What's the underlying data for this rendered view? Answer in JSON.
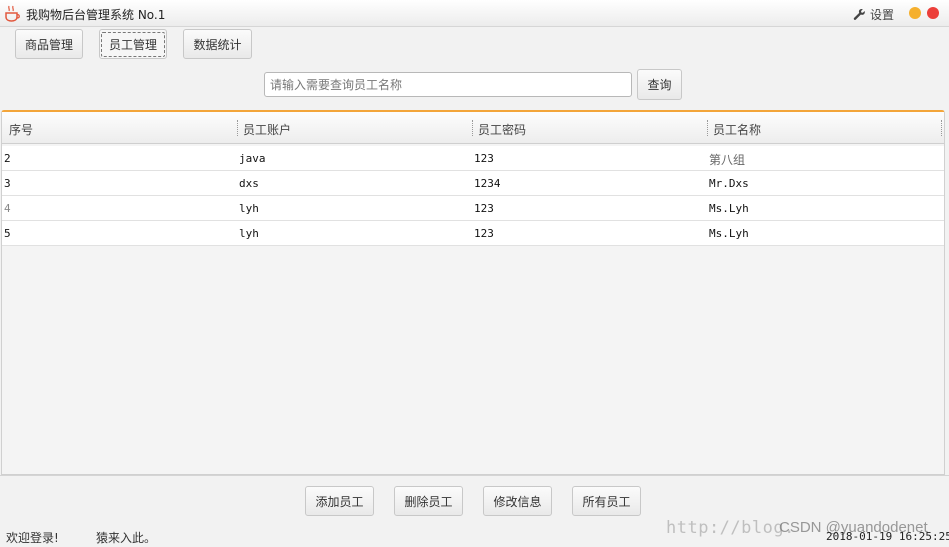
{
  "window": {
    "title": "我购物后台管理系统 No.1",
    "settings_label": "设置",
    "min_color": "#f5b02e",
    "close_color": "#ec3f3a"
  },
  "nav": {
    "products": "商品管理",
    "employees": "员工管理",
    "stats": "数据统计"
  },
  "search": {
    "placeholder": "请输入需要查询员工名称",
    "value": "",
    "button": "查询"
  },
  "table": {
    "accent_color": "#f3a53a",
    "headers": {
      "index": "序号",
      "account": "员工账户",
      "password": "员工密码",
      "name": "员工名称"
    },
    "rows": [
      {
        "index": "2",
        "account": "java",
        "password": "123",
        "name": "第八组"
      },
      {
        "index": "3",
        "account": "dxs",
        "password": "1234",
        "name": "Mr.Dxs"
      },
      {
        "index": "4",
        "account": "lyh",
        "password": "123",
        "name": "Ms.Lyh"
      },
      {
        "index": "5",
        "account": "lyh",
        "password": "123",
        "name": "Ms.Lyh"
      }
    ]
  },
  "actions": {
    "add": "添加员工",
    "delete": "删除员工",
    "edit": "修改信息",
    "all": "所有员工"
  },
  "status": {
    "welcome": "欢迎登录!",
    "user": "猿来入此。",
    "timestamp": "2018-01-19 16:25:25"
  },
  "watermark": {
    "url": "http://blog.",
    "csdn": "CSDN @yuandodenet"
  },
  "icons": {
    "app": "coffee-cup-icon",
    "settings": "wrench-icon"
  }
}
